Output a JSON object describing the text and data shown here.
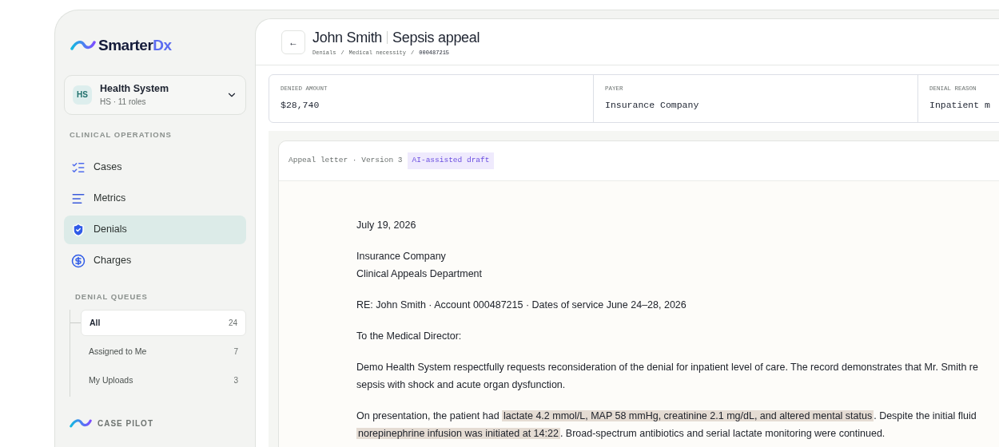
{
  "sidebar": {
    "logo": {
      "name": "Smarter",
      "accent": "Dx"
    },
    "org": {
      "initials": "HS",
      "name": "Health System",
      "subtitle": "HS · 11 roles"
    },
    "section_label": "CLINICAL OPERATIONS",
    "nav": [
      {
        "kind": "cases",
        "label": "Cases",
        "selected": false
      },
      {
        "kind": "metrics",
        "label": "Metrics",
        "selected": false
      },
      {
        "kind": "denials",
        "label": "Denials",
        "selected": true
      },
      {
        "kind": "charges",
        "label": "Charges",
        "selected": false
      }
    ],
    "queues_label": "DENIAL QUEUES",
    "queues": [
      {
        "label": "All",
        "count": "24",
        "selected": true
      },
      {
        "label": "Assigned to Me",
        "count": "7",
        "selected": false
      },
      {
        "label": "My Uploads",
        "count": "3",
        "selected": false
      }
    ],
    "footer_label": "CASE PILOT"
  },
  "header": {
    "back": "←",
    "patient": "John Smith",
    "title": "Sepsis appeal",
    "breadcrumb": [
      "Denials",
      "Medical necessity",
      "000487215"
    ],
    "breadcrumb_separator": "/"
  },
  "metrics": [
    {
      "label": "DENIED AMOUNT",
      "value": "$28,740"
    },
    {
      "label": "PAYER",
      "value": "Insurance Company"
    },
    {
      "label": "DENIAL REASON",
      "value": "Inpatient m"
    }
  ],
  "letter": {
    "caption": "Appeal letter · Version 3",
    "badge": "AI-assisted draft",
    "blocks": [
      {
        "lines": [
          [
            {
              "text": "July 19, 2026",
              "highlighted": false
            }
          ]
        ]
      },
      {
        "lines": [
          [
            {
              "text": "Insurance Company",
              "highlighted": false
            }
          ],
          [
            {
              "text": "Clinical Appeals Department",
              "highlighted": false
            }
          ]
        ]
      },
      {
        "lines": [
          [
            {
              "text": "RE: John Smith · Account 000487215 · Dates of service June 24–28, 2026",
              "highlighted": false
            }
          ]
        ]
      },
      {
        "lines": [
          [
            {
              "text": "To the Medical Director:",
              "highlighted": false
            }
          ]
        ]
      },
      {
        "lines": [
          [
            {
              "text": "Demo Health System respectfully requests reconsideration of the denial for inpatient level of care. The record demonstrates that Mr. Smith re",
              "highlighted": false
            }
          ],
          [
            {
              "text": "sepsis with shock and acute organ dysfunction.",
              "highlighted": false
            }
          ]
        ]
      },
      {
        "lines": [
          [
            {
              "text": "On presentation, the patient had ",
              "highlighted": false
            },
            {
              "text": "lactate 4.2 mmol/L, MAP 58 mmHg, creatinine 2.1 mg/dL, and altered mental status",
              "highlighted": true
            },
            {
              "text": ". Despite the initial fluid",
              "highlighted": false
            }
          ],
          [
            {
              "text": "norepinephrine infusion was initiated at 14:22",
              "highlighted": true
            },
            {
              "text": ". Broad-spectrum antibiotics and serial lactate monitoring were continued.",
              "highlighted": false
            }
          ]
        ]
      }
    ]
  }
}
